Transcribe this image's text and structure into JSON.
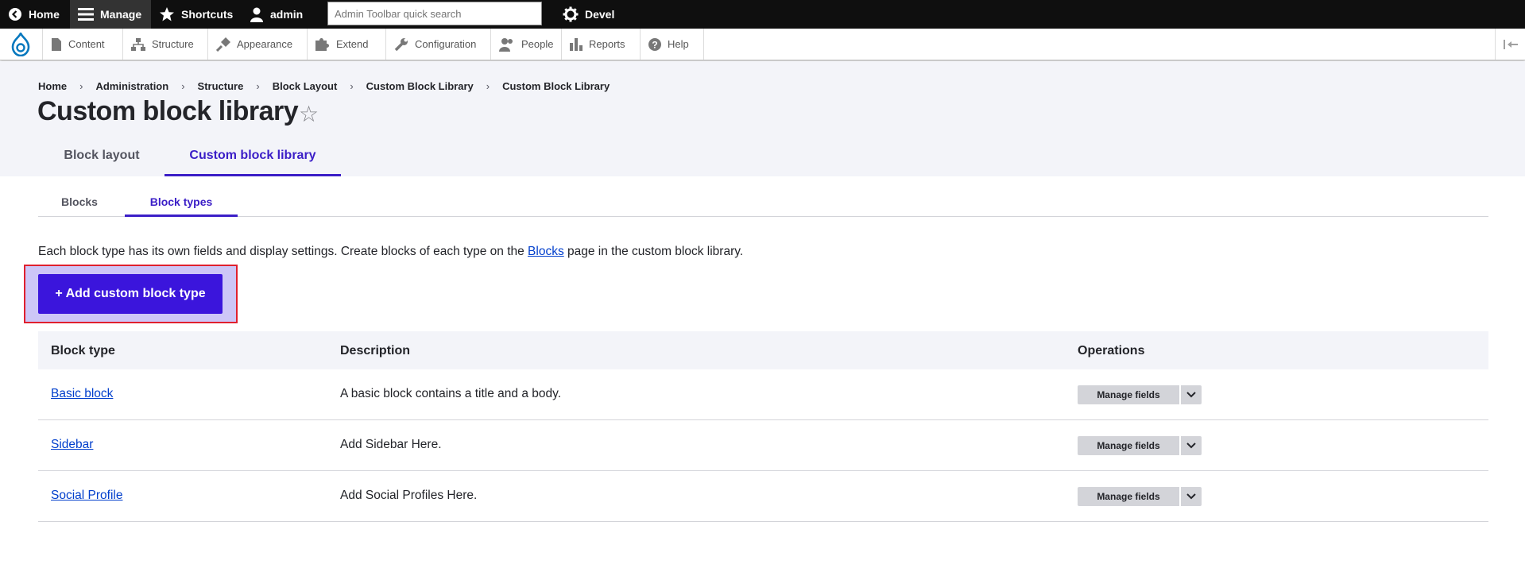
{
  "toolbar": {
    "home_label": "Home",
    "manage_label": "Manage",
    "shortcuts_label": "Shortcuts",
    "user_label": "admin",
    "search_placeholder": "Admin Toolbar quick search",
    "devel_label": "Devel"
  },
  "tray": {
    "items": [
      {
        "label": "Content",
        "icon": "file-icon"
      },
      {
        "label": "Structure",
        "icon": "structure-icon"
      },
      {
        "label": "Appearance",
        "icon": "brush-icon"
      },
      {
        "label": "Extend",
        "icon": "puzzle-icon"
      },
      {
        "label": "Configuration",
        "icon": "wrench-icon"
      },
      {
        "label": "People",
        "icon": "people-icon"
      },
      {
        "label": "Reports",
        "icon": "bar-chart-icon"
      },
      {
        "label": "Help",
        "icon": "help-icon"
      }
    ]
  },
  "breadcrumb": [
    "Home",
    "Administration",
    "Structure",
    "Block Layout",
    "Custom Block Library",
    "Custom Block Library"
  ],
  "page": {
    "title": "Custom block library",
    "primary_tabs": [
      "Block layout",
      "Custom block library"
    ],
    "secondary_tabs": [
      "Blocks",
      "Block types"
    ],
    "help_before": "Each block type has its own fields and display settings. Create blocks of each type on the ",
    "help_link": "Blocks",
    "help_after": " page in the custom block library.",
    "add_button": "+ Add custom block type"
  },
  "table": {
    "headers": [
      "Block type",
      "Description",
      "Operations"
    ],
    "rows": [
      {
        "name": "Basic block",
        "description": "A basic block contains a title and a body.",
        "operation": "Manage fields"
      },
      {
        "name": "Sidebar",
        "description": "Add Sidebar Here.",
        "operation": "Manage fields"
      },
      {
        "name": "Social Profile",
        "description": "Add Social Profiles Here.",
        "operation": "Manage fields"
      }
    ]
  },
  "colors": {
    "accent": "#3b15dc",
    "link": "#003ecc",
    "highlight_border": "#e0202e"
  }
}
